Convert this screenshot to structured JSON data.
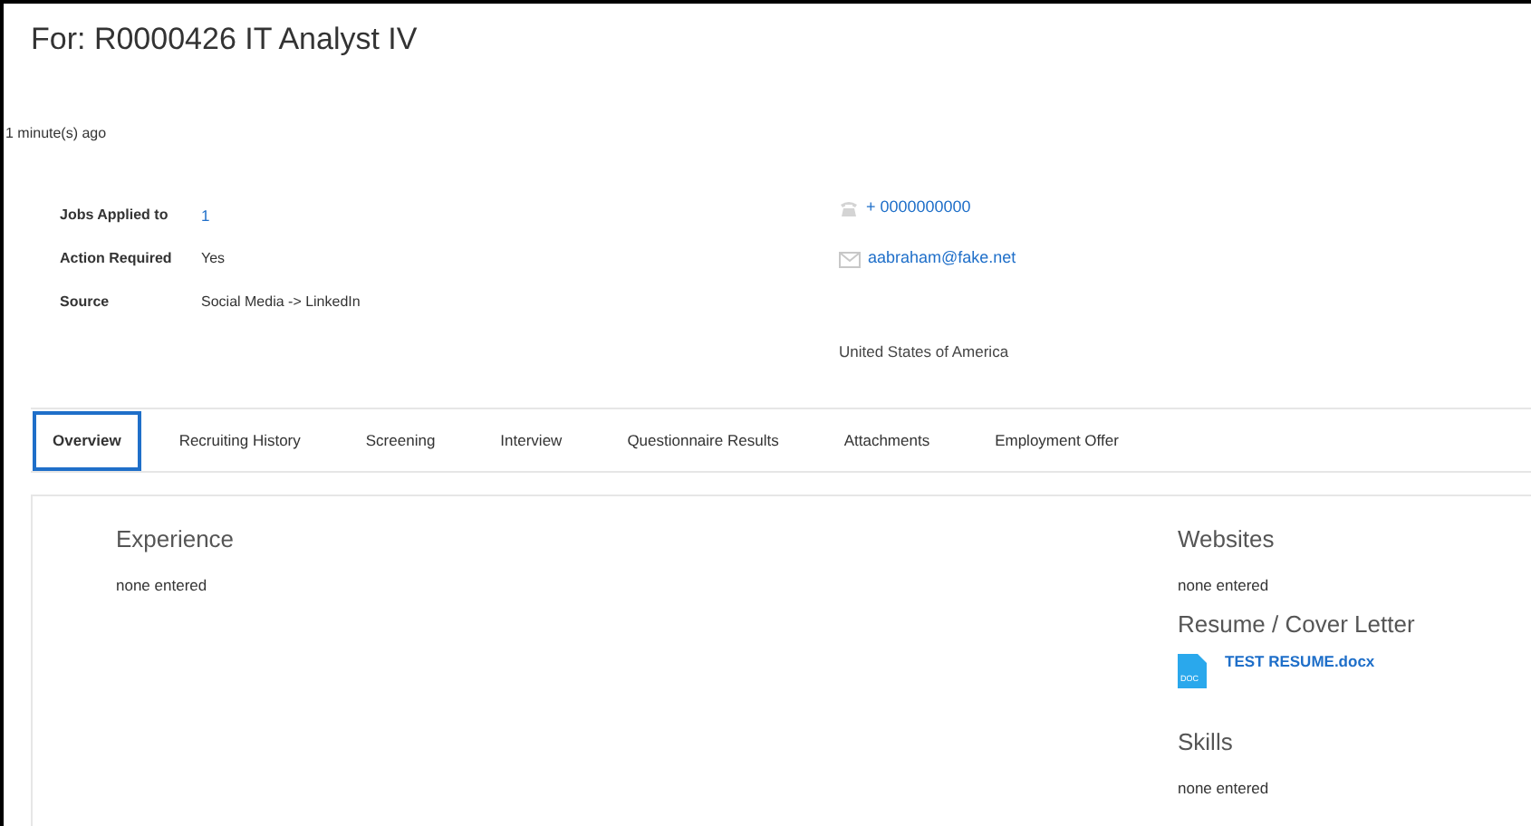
{
  "header": {
    "title": "For: R0000426 IT Analyst IV",
    "timestamp": "1 minute(s) ago"
  },
  "fields": [
    {
      "label": "Jobs Applied to",
      "value": "1",
      "kind": "link"
    },
    {
      "label": "Action Required",
      "value": "Yes",
      "kind": "plain"
    },
    {
      "label": "Source",
      "value": "Social Media -> LinkedIn",
      "kind": "plain"
    }
  ],
  "contacts": [
    {
      "kind": "phone",
      "value": "+ 0000000000"
    },
    {
      "kind": "email",
      "value": "aabraham@fake.net"
    },
    {
      "kind": "address",
      "value": "United States of America"
    }
  ],
  "tabs": [
    {
      "label": "Overview",
      "selected": true
    },
    {
      "label": "Recruiting History",
      "selected": false
    },
    {
      "label": "Screening",
      "selected": false
    },
    {
      "label": "Interview",
      "selected": false
    },
    {
      "label": "Questionnaire Results",
      "selected": false
    },
    {
      "label": "Attachments",
      "selected": false
    },
    {
      "label": "Employment Offer",
      "selected": false
    }
  ],
  "overview": {
    "left": [
      {
        "heading": "Experience",
        "text": "none entered"
      }
    ],
    "right": [
      {
        "heading": "Websites",
        "text": "none entered"
      },
      {
        "heading": "Resume / Cover Letter",
        "file": {
          "name": "TEST RESUME.docx",
          "icon_label": "DOC"
        }
      },
      {
        "heading": "Skills",
        "text": "none entered"
      }
    ]
  }
}
